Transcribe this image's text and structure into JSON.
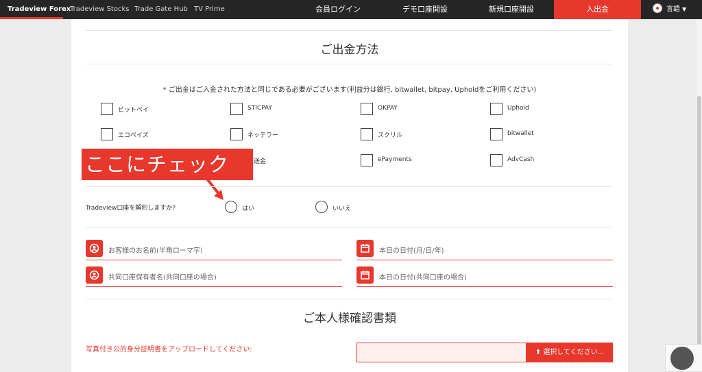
{
  "nav": {
    "brand": "Tradeview Forex",
    "links": [
      "Tradeview Stocks",
      "Trade Gate Hub",
      "TV Prime"
    ],
    "member_login": "会員ログイン",
    "demo_account": "デモ口座開設",
    "new_account": "新規口座開設",
    "deposit": "入出金",
    "language": "言語"
  },
  "section1": {
    "title": "ご出金方法",
    "note": "* ご出金はご入金された方法と同じである必要がございます(利益分は銀行, bitwallet, bitpay, Upholdをご利用ください)",
    "options_row1": [
      "ビットペイ",
      "STICPAY",
      "OKPAY",
      "Uphold"
    ],
    "options_row2": [
      "エコペイズ",
      "ネッテラー",
      "スクリル",
      "bitwallet"
    ],
    "options_row3": [
      "行送金",
      "ePayments",
      "AdvCash"
    ]
  },
  "callout": {
    "text": "ここにチェック"
  },
  "question": {
    "label": "Tradeview口座を解約しますか?",
    "yes": "はい",
    "no": "いいえ"
  },
  "fields": {
    "name": "お客様のお名前(半角ローマ字)",
    "date": "本日の日付(月/日/年)",
    "joint_name": "共同口座保有者名(共同口座の場合)",
    "joint_date": "本日の日付(共同口座の場合)"
  },
  "section2": {
    "title": "ご本人様確認書類",
    "upload_label": "写真付き公的身分証明書をアップロードしてください:",
    "upload_button": "選択してください..."
  },
  "colors": {
    "accent": "#e8372c",
    "nav_bg": "#262626"
  }
}
